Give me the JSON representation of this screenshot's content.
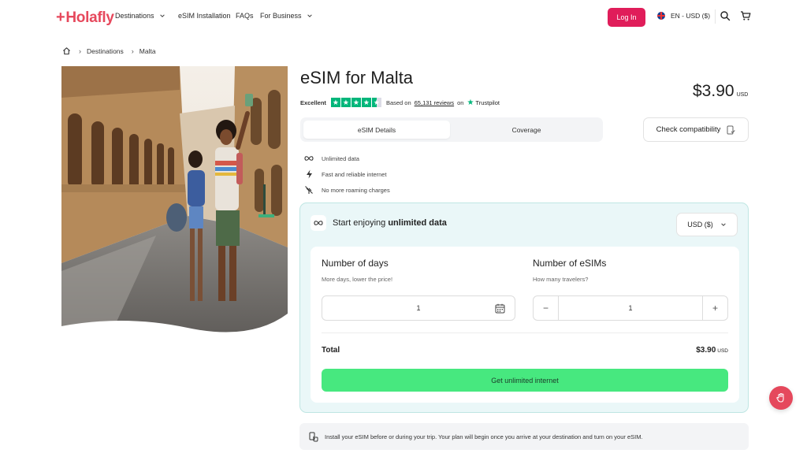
{
  "header": {
    "logo": "Holafly",
    "nav": [
      {
        "label": "Destinations",
        "has_dropdown": true
      },
      {
        "label": "eSIM Installation",
        "has_dropdown": false
      },
      {
        "label": "FAQs",
        "has_dropdown": false
      },
      {
        "label": "For Business",
        "has_dropdown": true
      }
    ],
    "login_label": "Log In",
    "language": "EN - USD ($)",
    "icons": [
      "search-icon",
      "cart-icon"
    ]
  },
  "breadcrumb": {
    "items": [
      "Destinations",
      "Malta"
    ],
    "home_icon": "home-icon"
  },
  "product": {
    "title": "eSIM for Malta",
    "rating_label": "Excellent",
    "based_on": "Based on",
    "reviews": "65,131 reviews",
    "on": "on",
    "trustpilot": "Trustpilot",
    "price": "$3.90",
    "price_currency": "USD"
  },
  "tabs": {
    "details": "eSIM Details",
    "coverage": "Coverage"
  },
  "check_compatibility": "Check compatibility",
  "features": [
    {
      "icon": "infinity-icon",
      "label": "Unlimited data"
    },
    {
      "icon": "lightning-icon",
      "label": "Fast and reliable internet"
    },
    {
      "icon": "no-roaming-icon",
      "label": "No more roaming charges"
    }
  ],
  "plan": {
    "heading_prefix": "Start enjoying",
    "heading_bold": "unlimited data",
    "currency_select": "USD ($)",
    "days": {
      "title": "Number of days",
      "subtitle": "More days, lower the price!",
      "value": "1"
    },
    "esims": {
      "title": "Number of eSIMs",
      "subtitle": "How many travelers?",
      "value": "1",
      "minus": "−",
      "plus": "+"
    },
    "total_label": "Total",
    "total_value": "$3.90",
    "total_currency": "USD",
    "cta": "Get unlimited internet"
  },
  "info_banner": "Install your eSIM before or during your trip. Your plan will begin once you arrive at your destination and turn on your eSIM.",
  "colors": {
    "brand": "#e6485c",
    "login": "#e01d5a",
    "cta": "#47e87f",
    "trustpilot": "#00b67a",
    "plan_bg": "#eaf7f8"
  }
}
